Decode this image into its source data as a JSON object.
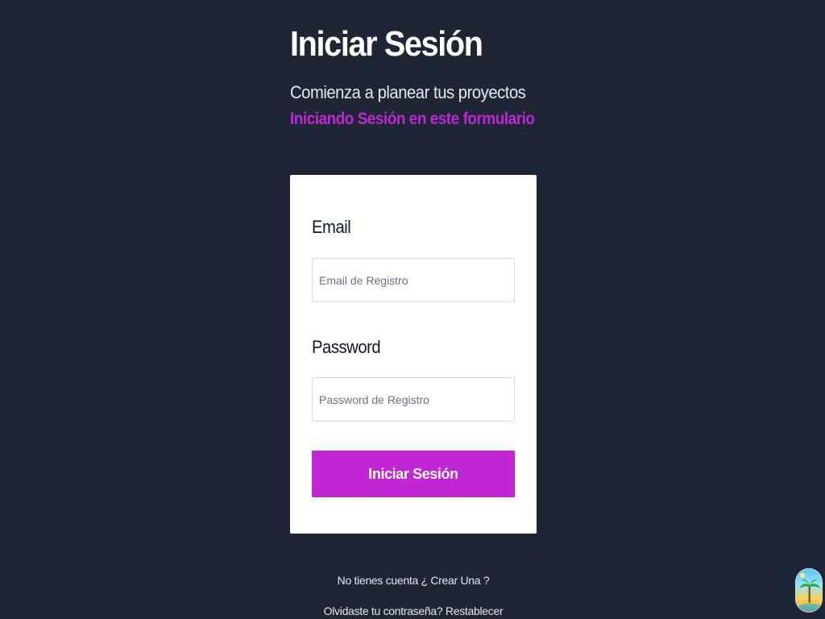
{
  "header": {
    "title": "Iniciar Sesión",
    "subtitle": "Comienza a planear tus proyectos",
    "subtitle_accent": "Iniciando Sesión en este formulario"
  },
  "form": {
    "email_label": "Email",
    "email_placeholder": "Email de Registro",
    "email_value": "",
    "password_label": "Password",
    "password_placeholder": "Password de Registro",
    "password_value": "",
    "submit_label": "Iniciar Sesión"
  },
  "links": {
    "create_account": "No tienes cuenta ¿ Crear Una ?",
    "reset_password": "Olvidaste tu contraseña? Restablecer"
  },
  "colors": {
    "background": "#1e2636",
    "accent": "#c026d3",
    "card": "#ffffff"
  },
  "icons": {
    "app_badge": "beach-island-icon"
  }
}
